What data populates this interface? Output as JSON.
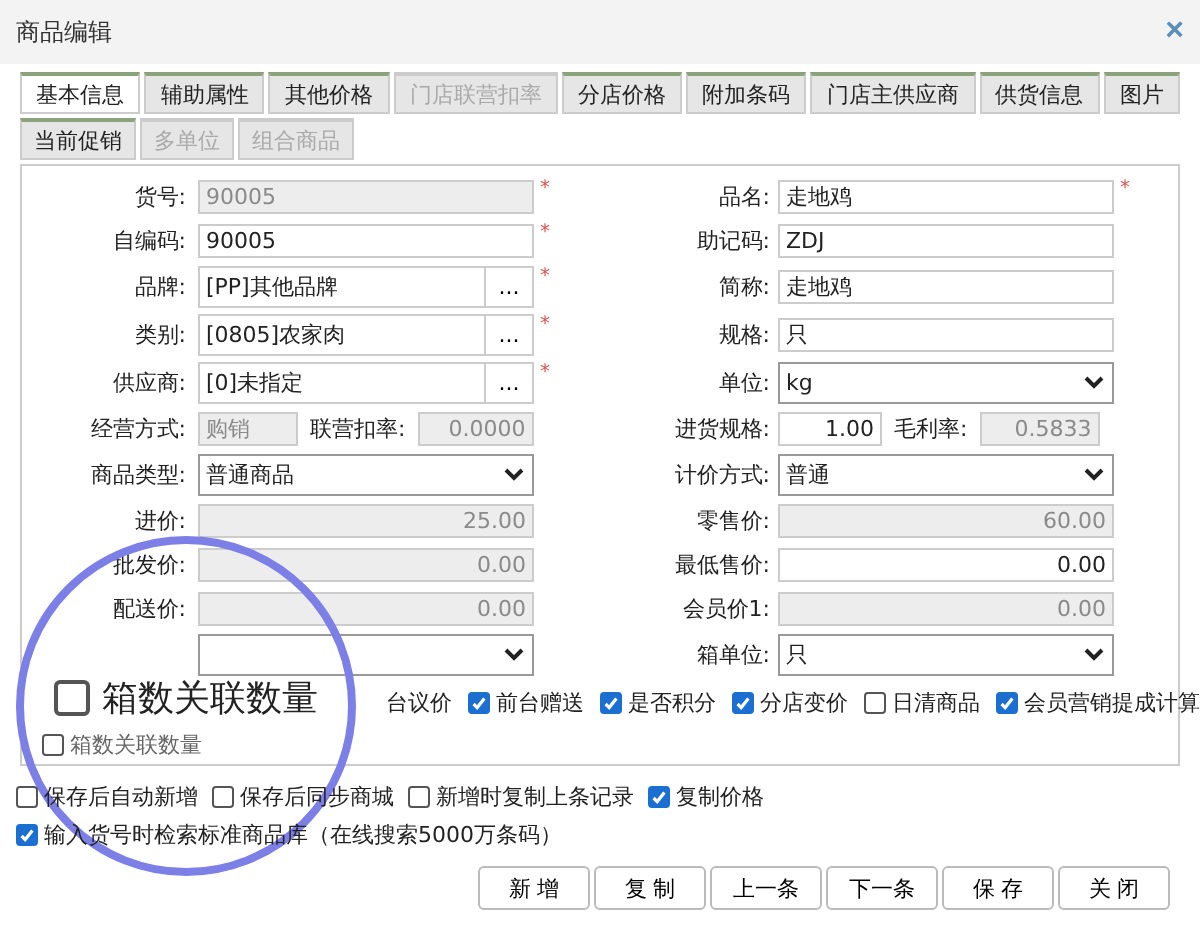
{
  "window": {
    "title": "商品编辑",
    "close": "×"
  },
  "tabs": [
    {
      "label": "基本信息",
      "selected": true,
      "disabled": false
    },
    {
      "label": "辅助属性",
      "selected": false,
      "disabled": false
    },
    {
      "label": "其他价格",
      "selected": false,
      "disabled": false
    },
    {
      "label": "门店联营扣率",
      "selected": false,
      "disabled": true
    },
    {
      "label": "分店价格",
      "selected": false,
      "disabled": false
    },
    {
      "label": "附加条码",
      "selected": false,
      "disabled": false
    },
    {
      "label": "门店主供应商",
      "selected": false,
      "disabled": false
    },
    {
      "label": "供货信息",
      "selected": false,
      "disabled": false
    },
    {
      "label": "图片",
      "selected": false,
      "disabled": false
    },
    {
      "label": "当前促销",
      "selected": false,
      "disabled": false
    },
    {
      "label": "多单位",
      "selected": false,
      "disabled": true
    },
    {
      "label": "组合商品",
      "selected": false,
      "disabled": true
    }
  ],
  "rows": [
    {
      "left": {
        "kind": "text",
        "label": "货号:",
        "value": "90005",
        "disabled": true,
        "required_mark": "*"
      },
      "right": {
        "kind": "text",
        "label": "品名:",
        "value": "走地鸡",
        "disabled": false,
        "required_mark": "*"
      }
    },
    {
      "left": {
        "kind": "text",
        "label": "自编码:",
        "value": "90005",
        "disabled": false,
        "required_mark": "*"
      },
      "right": {
        "kind": "text",
        "label": "助记码:",
        "value": "ZDJ",
        "disabled": false
      }
    },
    {
      "left": {
        "kind": "picker",
        "label": "品牌:",
        "value": "[PP]其他品牌",
        "button": "...",
        "disabled": false,
        "required_mark": "*"
      },
      "right": {
        "kind": "text",
        "label": "简称:",
        "value": "走地鸡",
        "disabled": false
      }
    },
    {
      "left": {
        "kind": "picker",
        "label": "类别:",
        "value": "[0805]农家肉",
        "button": "...",
        "disabled": false,
        "required_mark": "*"
      },
      "right": {
        "kind": "text",
        "label": "规格:",
        "value": "只",
        "disabled": false
      }
    },
    {
      "left": {
        "kind": "picker",
        "label": "供应商:",
        "value": "[0]未指定",
        "button": "...",
        "disabled": false,
        "required_mark": "*"
      },
      "right": {
        "kind": "select",
        "label": "单位:",
        "value": "kg",
        "disabled": false
      }
    },
    {
      "left": {
        "kind": "pair",
        "label": "经营方式:",
        "value": "购销",
        "disabled": true,
        "label2": "联营扣率:",
        "value2": "0.0000",
        "disabled2": true
      },
      "right": {
        "kind": "pair",
        "label": "进货规格:",
        "value": "1.00",
        "disabled": false,
        "label2": "毛利率:",
        "value2": "0.5833",
        "disabled2": true
      }
    },
    {
      "left": {
        "kind": "select",
        "label": "商品类型:",
        "value": "普通商品",
        "disabled": false
      },
      "right": {
        "kind": "select",
        "label": "计价方式:",
        "value": "普通",
        "disabled": false
      }
    },
    {
      "left": {
        "kind": "number",
        "label": "进价:",
        "value": "25.00",
        "disabled": true
      },
      "right": {
        "kind": "number",
        "label": "零售价:",
        "value": "60.00",
        "disabled": true
      }
    },
    {
      "left": {
        "kind": "number",
        "label": "批发价:",
        "value": "0.00",
        "disabled": true
      },
      "right": {
        "kind": "number",
        "label": "最低售价:",
        "value": "0.00",
        "disabled": false
      }
    },
    {
      "left": {
        "kind": "number",
        "label": "配送价:",
        "value": "0.00",
        "disabled": true
      },
      "right": {
        "kind": "number",
        "label": "会员价1:",
        "value": "0.00",
        "disabled": true
      }
    },
    {
      "left": {
        "kind": "select",
        "disabled": false
      },
      "right": {
        "kind": "select",
        "label": "箱单位:",
        "value": "只",
        "disabled": false
      }
    }
  ],
  "flags": [
    {
      "label": "台议价"
    },
    {
      "label": "前台赠送",
      "checked": true
    },
    {
      "label": "是否积分",
      "checked": true
    },
    {
      "label": "分店变价",
      "checked": true
    },
    {
      "label": "日清商品",
      "checked": false
    },
    {
      "label": "会员营销提成计算",
      "checked": true
    }
  ],
  "box_link": {
    "label": "箱数关联数量",
    "checked": false
  },
  "options": [
    {
      "label": "保存后自动新增",
      "checked": false
    },
    {
      "label": "保存后同步商城",
      "checked": false
    },
    {
      "label": "新增时复制上条记录",
      "checked": false
    },
    {
      "label": "复制价格",
      "checked": true
    },
    {
      "label": "输入货号时检索标准商品库（在线搜索5000万条码）",
      "checked": true
    }
  ],
  "buttons": [
    "新 增",
    "复 制",
    "上一条",
    "下一条",
    "保 存",
    "关 闭"
  ],
  "magnifier": {
    "label": "箱数关联数量",
    "checked": false
  }
}
